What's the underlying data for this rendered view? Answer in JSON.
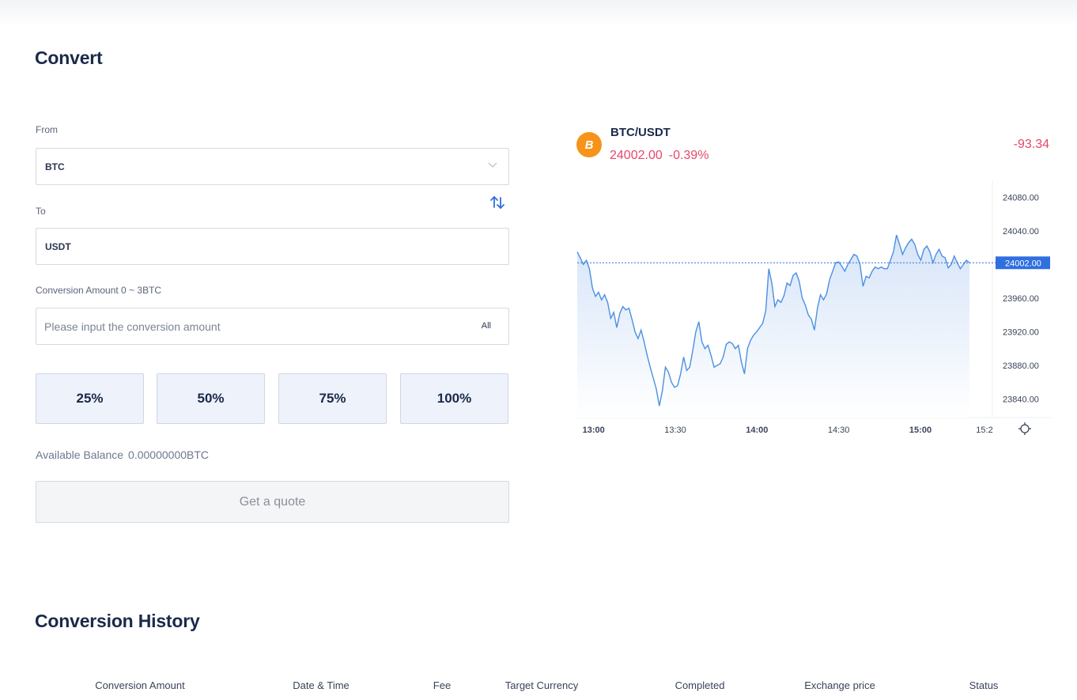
{
  "page": {
    "title": "Convert",
    "history_title": "Conversion History"
  },
  "form": {
    "from_label": "From",
    "from_value": "BTC",
    "to_label": "To",
    "to_value": "USDT",
    "amount_label": "Conversion Amount 0 ~ 3BTC",
    "amount_placeholder": "Please input the conversion amount",
    "all_label": "All",
    "percent_buttons": [
      "25%",
      "50%",
      "75%",
      "100%"
    ],
    "balance_label": "Available Balance",
    "balance_value": "0.00000000BTC",
    "quote_button": "Get a quote"
  },
  "ticker": {
    "pair": "BTC/USDT",
    "price": "24002.00",
    "change_pct": "-0.39%",
    "change_abs": "-93.34",
    "coin_icon": "bitcoin-icon",
    "down_color": "#e6476a",
    "brand_color": "#f7931a"
  },
  "chart_data": {
    "type": "area",
    "x_ticks": [
      "13:00",
      "13:30",
      "14:00",
      "14:30",
      "15:00",
      "15:2"
    ],
    "y_ticks": [
      "24080.00",
      "24040.00",
      "23960.00",
      "23920.00",
      "23880.00",
      "23840.00"
    ],
    "y_tick_values": [
      24080,
      24040,
      23960,
      23920,
      23880,
      23840
    ],
    "last_price_label": "24002.00",
    "last_price": 24002,
    "ylim": [
      23818,
      24100
    ],
    "x_range_minutes": [
      0,
      144
    ],
    "line_color": "#4a90e2",
    "values": [
      24015,
      24008,
      24000,
      24005,
      23995,
      23972,
      23962,
      23967,
      23958,
      23964,
      23955,
      23936,
      23943,
      23925,
      23942,
      23950,
      23946,
      23948,
      23935,
      23920,
      23912,
      23922,
      23908,
      23892,
      23878,
      23865,
      23852,
      23832,
      23850,
      23878,
      23872,
      23860,
      23854,
      23856,
      23870,
      23890,
      23874,
      23878,
      23898,
      23920,
      23932,
      23908,
      23900,
      23904,
      23892,
      23878,
      23880,
      23882,
      23890,
      23905,
      23908,
      23906,
      23900,
      23904,
      23884,
      23870,
      23900,
      23910,
      23916,
      23920,
      23925,
      23930,
      23945,
      23995,
      23978,
      23950,
      23958,
      23955,
      23963,
      23978,
      23975,
      23987,
      23990,
      23980,
      23960,
      23952,
      23940,
      23935,
      23922,
      23948,
      23964,
      23958,
      23965,
      23982,
      23992,
      24002,
      24003,
      23998,
      23992,
      24000,
      24006,
      24012,
      24010,
      24000,
      23974,
      23986,
      23984,
      23992,
      23997,
      23995,
      23997,
      23995,
      23995,
      24005,
      24015,
      24035,
      24024,
      24012,
      24020,
      24026,
      24030,
      24024,
      24012,
      24005,
      24018,
      24022,
      24015,
      24002,
      24012,
      24018,
      24010,
      24008,
      23996,
      24000,
      24010,
      24002,
      23995,
      24000,
      24005,
      24002
    ]
  },
  "history_table": {
    "columns": [
      "Conversion Amount",
      "Date & Time",
      "Fee",
      "Target Currency",
      "Completed",
      "Exchange price",
      "Status"
    ]
  }
}
